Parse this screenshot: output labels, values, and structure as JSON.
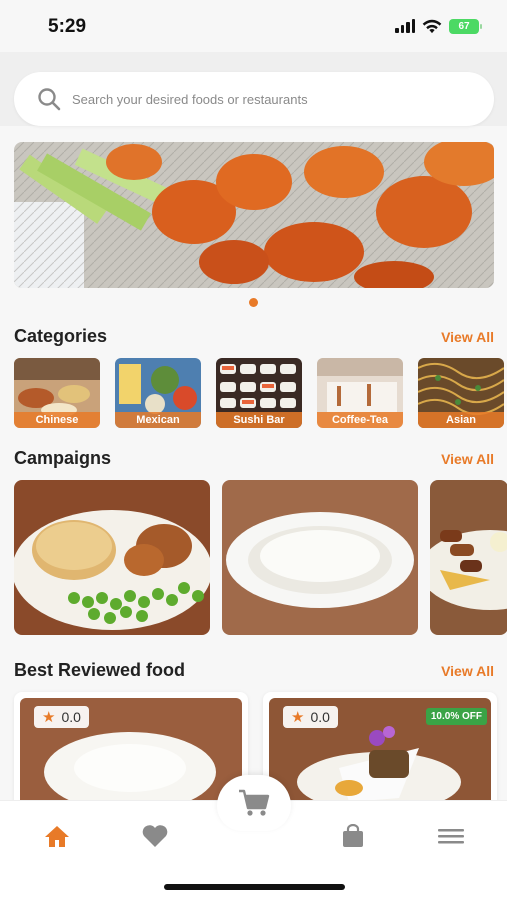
{
  "status_bar": {
    "time": "5:29",
    "battery": "67"
  },
  "search": {
    "placeholder": "Search your desired foods or restaurants"
  },
  "colors": {
    "accent": "#e87a28",
    "discount_badge": "#3aa346",
    "icon_inactive": "#8a8a8a"
  },
  "categories": {
    "title": "Categories",
    "view_all": "View All",
    "items": [
      {
        "label": "Chinese"
      },
      {
        "label": "Mexican"
      },
      {
        "label": "Sushi Bar"
      },
      {
        "label": "Coffee-Tea"
      },
      {
        "label": "Asian"
      }
    ]
  },
  "campaigns": {
    "title": "Campaigns",
    "view_all": "View All"
  },
  "best_reviewed": {
    "title": "Best Reviewed food",
    "view_all": "View All",
    "items": [
      {
        "rating": "0.0",
        "discount": ""
      },
      {
        "rating": "0.0",
        "discount": "10.0% OFF"
      }
    ]
  },
  "bottom_nav": {
    "items": [
      "home-icon",
      "heart-icon",
      "cart-icon",
      "bag-icon",
      "menu-icon"
    ],
    "active": "home-icon"
  }
}
